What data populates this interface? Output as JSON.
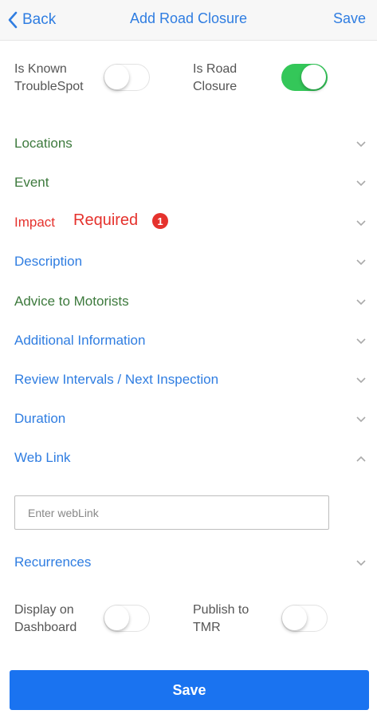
{
  "navbar": {
    "back_label": "Back",
    "title": "Add Road Closure",
    "save_label": "Save"
  },
  "top_toggles": {
    "known_troublespot": {
      "label_line1": "Is Known",
      "label_line2": "TroubleSpot",
      "on": false
    },
    "road_closure": {
      "label_line1": "Is Road",
      "label_line2": "Closure",
      "on": true
    }
  },
  "sections": {
    "locations": {
      "label": "Locations",
      "color": "#3d7a3d",
      "expanded": false
    },
    "event": {
      "label": "Event",
      "color": "#3d7a3d",
      "expanded": false
    },
    "impact": {
      "label": "Impact",
      "color": "#e5322d",
      "required_text": "Required",
      "required_count": "1",
      "expanded": false
    },
    "description": {
      "label": "Description",
      "color": "#2f7de1",
      "expanded": false
    },
    "advice": {
      "label": "Advice to Motorists",
      "color": "#3d7a3d",
      "expanded": false
    },
    "additional": {
      "label": "Additional Information",
      "color": "#2f7de1",
      "expanded": false
    },
    "review": {
      "label": "Review Intervals / Next Inspection",
      "color": "#2f7de1",
      "expanded": false
    },
    "duration": {
      "label": "Duration",
      "color": "#2f7de1",
      "expanded": false
    },
    "weblink": {
      "label": "Web Link",
      "color": "#2f7de1",
      "expanded": true,
      "input_value": "",
      "input_placeholder": "Enter webLink"
    },
    "recurrences": {
      "label": "Recurrences",
      "color": "#2f7de1",
      "expanded": false
    }
  },
  "bottom_toggles": {
    "dashboard": {
      "label_line1": "Display on",
      "label_line2": "Dashboard",
      "on": false
    },
    "tmr": {
      "label_line1": "Publish to",
      "label_line2": "TMR",
      "on": false
    }
  },
  "footer": {
    "save_label": "Save"
  },
  "colors": {
    "accent": "#2f7de1",
    "switch_on": "#34c759",
    "error": "#e5322d",
    "button": "#1a73f0"
  }
}
